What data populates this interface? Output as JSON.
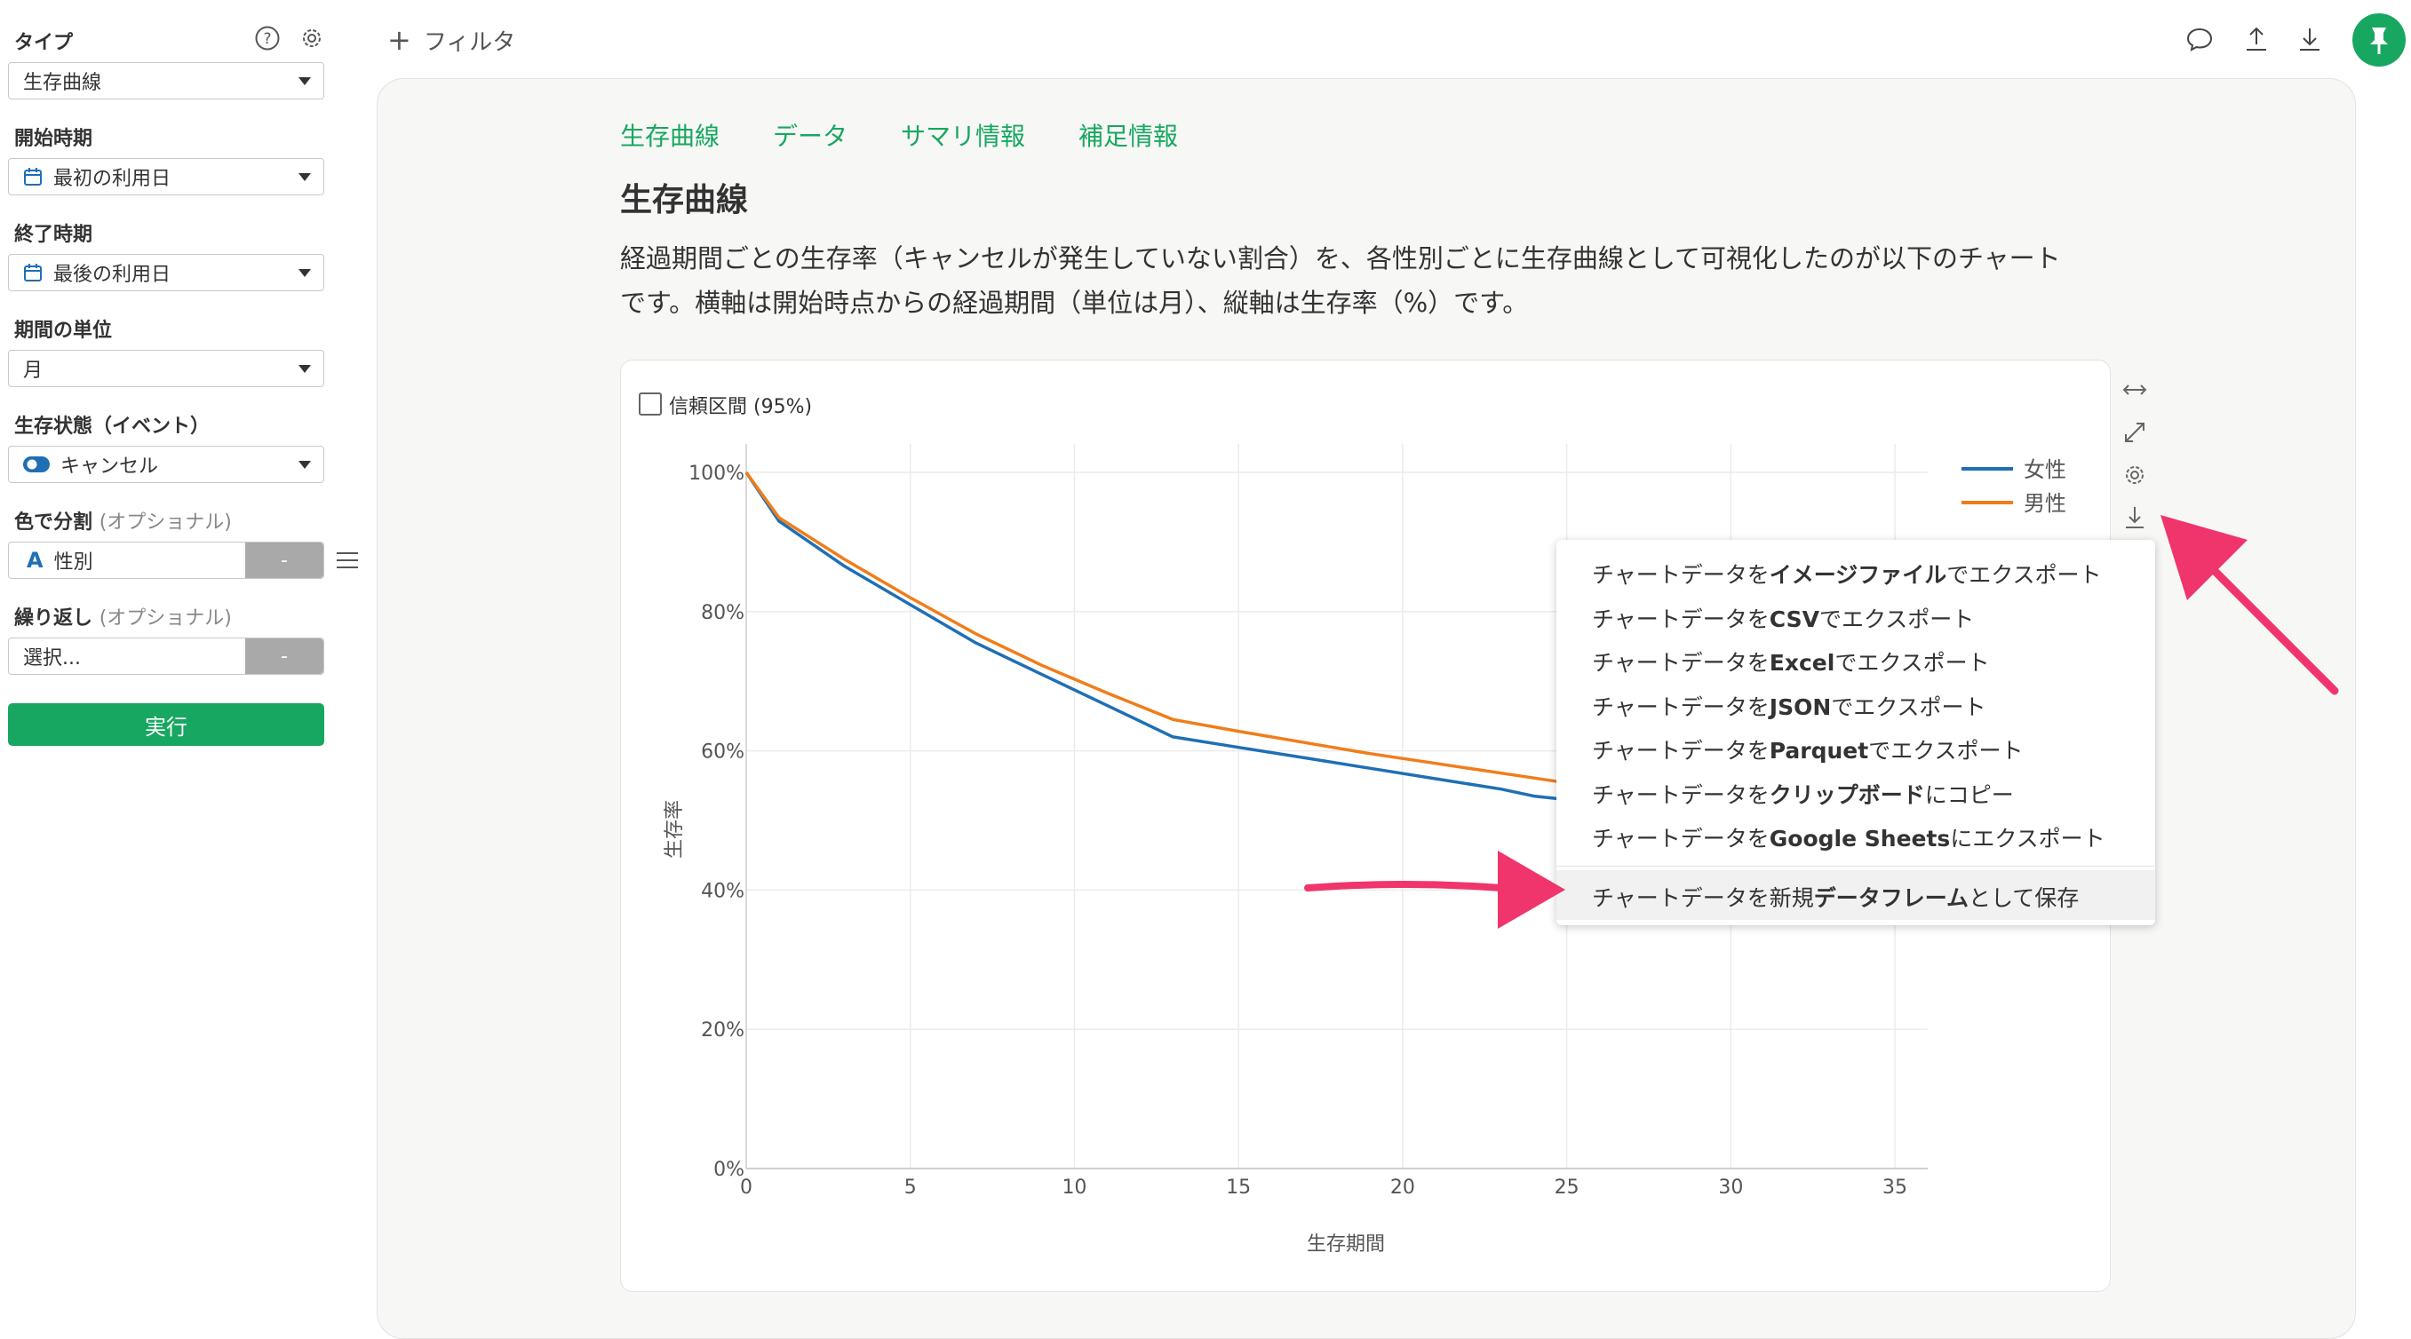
{
  "sidebar": {
    "type_label": "タイプ",
    "type_value": "生存曲線",
    "start_label": "開始時期",
    "start_value": "最初の利用日",
    "end_label": "終了時期",
    "end_value": "最後の利用日",
    "unit_label": "期間の単位",
    "unit_value": "月",
    "status_label": "生存状態（イベント）",
    "status_value": "キャンセル",
    "color_label": "色で分割",
    "color_optional": "(オプショナル)",
    "color_value": "性別",
    "color_type_glyph": "A",
    "color_remove": "-",
    "repeat_label": "繰り返し",
    "repeat_optional": "(オプショナル)",
    "repeat_placeholder": "選択...",
    "repeat_remove": "-",
    "run_label": "実行"
  },
  "topbar": {
    "filter_label": "フィルタ",
    "filter_plus": "+"
  },
  "tabs": [
    "生存曲線",
    "データ",
    "サマリ情報",
    "補足情報"
  ],
  "main": {
    "title": "生存曲線",
    "description_line1": "経過期間ごとの生存率（キャンセルが発生していない割合）を、各性別ごとに生存曲線として可視化したのが以下のチャート",
    "description_line2": "です。横軸は開始時点からの経過期間（単位は月）、縦軸は生存率（%）です。",
    "confidence_label": "信頼区間 (95%)"
  },
  "chart_data": {
    "type": "line",
    "title": "",
    "xlabel": "生存期間",
    "ylabel": "生存率",
    "xlim": [
      0,
      36
    ],
    "ylim": [
      0,
      100
    ],
    "x_ticks": [
      0,
      5,
      10,
      15,
      20,
      25,
      30,
      35
    ],
    "y_ticks": [
      0,
      20,
      40,
      60,
      80,
      100
    ],
    "y_tick_labels": [
      "0%",
      "20%",
      "40%",
      "60%",
      "80%",
      "100%"
    ],
    "grid": true,
    "legend_position": "top-right",
    "series": [
      {
        "name": "女性",
        "color": "#1f6fb5",
        "x": [
          0,
          1,
          3,
          5,
          7,
          9,
          11,
          13,
          15,
          17,
          19,
          21,
          23,
          24,
          25,
          27,
          29,
          31,
          33,
          35
        ],
        "y": [
          100,
          93,
          86.5,
          81,
          75.5,
          71,
          66.5,
          62,
          60.5,
          59,
          57.5,
          56,
          54.5,
          53.5,
          53,
          51.5,
          50,
          48.5,
          47,
          45.5
        ]
      },
      {
        "name": "男性",
        "color": "#f07d1a",
        "x": [
          0,
          1,
          3,
          5,
          7,
          9,
          11,
          13,
          15,
          17,
          19,
          21,
          23,
          25,
          27,
          29,
          31,
          33,
          35
        ],
        "y": [
          100,
          93.5,
          87.5,
          82,
          76.8,
          72.3,
          68.3,
          64.5,
          62.8,
          61.2,
          59.6,
          58.2,
          56.8,
          55.4,
          54,
          52.6,
          51.2,
          49.8,
          48.4
        ]
      }
    ]
  },
  "export_menu": {
    "items": [
      {
        "pre": "チャートデータを",
        "bold": "イメージファイル",
        "post": "でエクスポート"
      },
      {
        "pre": "チャートデータを",
        "bold": "CSV",
        "post": "でエクスポート"
      },
      {
        "pre": "チャートデータを",
        "bold": "Excel",
        "post": "でエクスポート"
      },
      {
        "pre": "チャートデータを",
        "bold": "JSON",
        "post": "でエクスポート"
      },
      {
        "pre": "チャートデータを",
        "bold": "Parquet",
        "post": "でエクスポート"
      },
      {
        "pre": "チャートデータを",
        "bold": "クリップボード",
        "post": "にコピー"
      },
      {
        "pre": "チャートデータを",
        "bold": "Google Sheets",
        "post": "にエクスポート"
      },
      {
        "pre": "チャートデータを新規",
        "bold": "データフレーム",
        "post": "として保存"
      }
    ]
  },
  "colors": {
    "accent": "#18a760",
    "annotation_arrow": "#f0346c",
    "panel_bg": "#f7f7f6"
  }
}
